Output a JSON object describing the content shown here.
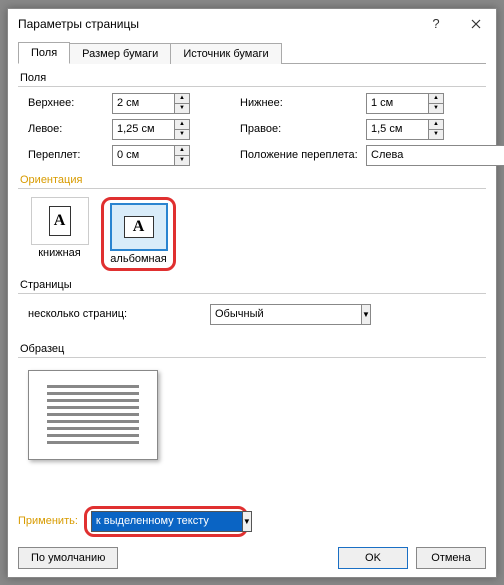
{
  "title": "Параметры страницы",
  "tabs": {
    "fields": "Поля",
    "paper": "Размер бумаги",
    "source": "Источник бумаги"
  },
  "margins": {
    "section": "Поля",
    "top_label": "Верхнее:",
    "top_value": "2 см",
    "bottom_label": "Нижнее:",
    "bottom_value": "1 см",
    "left_label": "Левое:",
    "left_value": "1,25 см",
    "right_label": "Правое:",
    "right_value": "1,5 см",
    "gutter_label": "Переплет:",
    "gutter_value": "0 см",
    "gutter_pos_label": "Положение переплета:",
    "gutter_pos_value": "Слева"
  },
  "orientation": {
    "section": "Ориентация",
    "portrait": "книжная",
    "landscape": "альбомная",
    "selected": "landscape"
  },
  "pages": {
    "section": "Страницы",
    "multi_label": "несколько страниц:",
    "multi_value": "Обычный"
  },
  "preview": {
    "section": "Образец"
  },
  "apply": {
    "label": "Применить:",
    "value": "к выделенному тексту"
  },
  "buttons": {
    "default": "По умолчанию",
    "ok": "OK",
    "cancel": "Отмена"
  }
}
